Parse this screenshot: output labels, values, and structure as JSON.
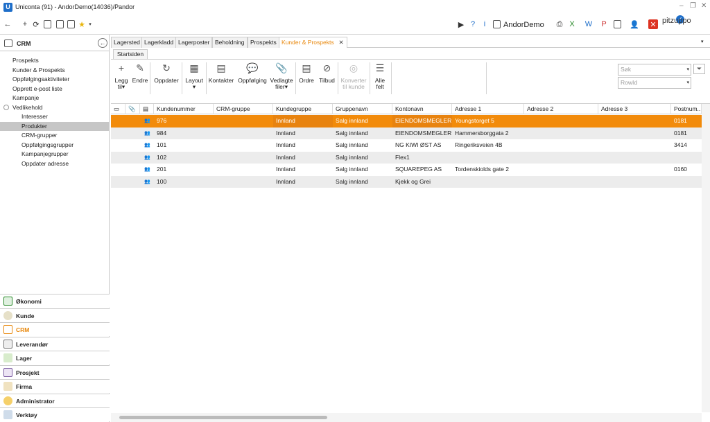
{
  "window": {
    "title": "Uniconta (91)  - AndorDemo(14036)/Pandor"
  },
  "toolbar": {
    "company": "AndorDemo",
    "brand": "pitzuppo"
  },
  "crm": {
    "header": "CRM"
  },
  "nav": [
    "Prospekts",
    "Kunder & Prospekts",
    "Oppfølgingsaktiviteter",
    "Opprett e-post liste",
    "Kampanje",
    "Vedlikehold",
    "Interesser",
    "Produkter",
    "CRM-grupper",
    "Oppfølgingsgrupper",
    "Kampanjegrupper",
    "Oppdater adresse"
  ],
  "modules": [
    "Økonomi",
    "Kunde",
    "CRM",
    "Leverandør",
    "Lager",
    "Prosjekt",
    "Firma",
    "Administrator",
    "Verktøy"
  ],
  "tabs": [
    "Lagersted",
    "Lagerkladd",
    "Lagerposter",
    "Beholdning",
    "Prospekts",
    "Kunder & Prospekts"
  ],
  "subtab": "Startsiden",
  "ribbon": {
    "legg": "Legg",
    "til": "til",
    "endre": "Endre",
    "oppdater": "Oppdater",
    "layout": "Layout",
    "kontakter": "Kontakter",
    "oppfolging": "Oppfølging",
    "vedlagte1": "Vedlagte",
    "vedlagte2": "filer",
    "ordre": "Ordre",
    "tilbud": "Tilbud",
    "konverter1": "Konverter",
    "konverter2": "til kunde",
    "alle1": "Alle",
    "alle2": "felt"
  },
  "search": {
    "placeholder": "Søk",
    "rowid": "RowId"
  },
  "columns": [
    "Kundenummer",
    "CRM-gruppe",
    "Kundegruppe",
    "Gruppenavn",
    "Kontonavn",
    "Adresse 1",
    "Adresse 2",
    "Adresse 3",
    "Postnum..."
  ],
  "rows": [
    {
      "nr": "976",
      "crm": "",
      "kg": "Innland",
      "gn": "Salg innland",
      "kn": "EIENDOMSMEGLER...",
      "a1": "Youngstorget 5",
      "a2": "",
      "a3": "",
      "pn": "0181"
    },
    {
      "nr": "984",
      "crm": "",
      "kg": "Innland",
      "gn": "Salg innland",
      "kn": "EIENDOMSMEGLER...",
      "a1": "Hammersborggata 2",
      "a2": "",
      "a3": "",
      "pn": "0181"
    },
    {
      "nr": "101",
      "crm": "",
      "kg": "Innland",
      "gn": "Salg innland",
      "kn": "NG KIWI ØST AS",
      "a1": "Ringeriksveien 4B",
      "a2": "",
      "a3": "",
      "pn": "3414"
    },
    {
      "nr": "102",
      "crm": "",
      "kg": "Innland",
      "gn": "Salg innland",
      "kn": "Flex1",
      "a1": "",
      "a2": "",
      "a3": "",
      "pn": ""
    },
    {
      "nr": "201",
      "crm": "",
      "kg": "Innland",
      "gn": "Salg innland",
      "kn": "SQUAREPEG AS",
      "a1": "Tordenskiolds gate 2",
      "a2": "",
      "a3": "",
      "pn": "0160"
    },
    {
      "nr": "100",
      "crm": "",
      "kg": "Innland",
      "gn": "Salg innland",
      "kn": "Kjekk og Grei",
      "a1": "",
      "a2": "",
      "a3": "",
      "pn": ""
    }
  ],
  "colors": {
    "accent": "#e8870b",
    "selection": "#f28b0b",
    "brand": "#1e6ec9"
  }
}
